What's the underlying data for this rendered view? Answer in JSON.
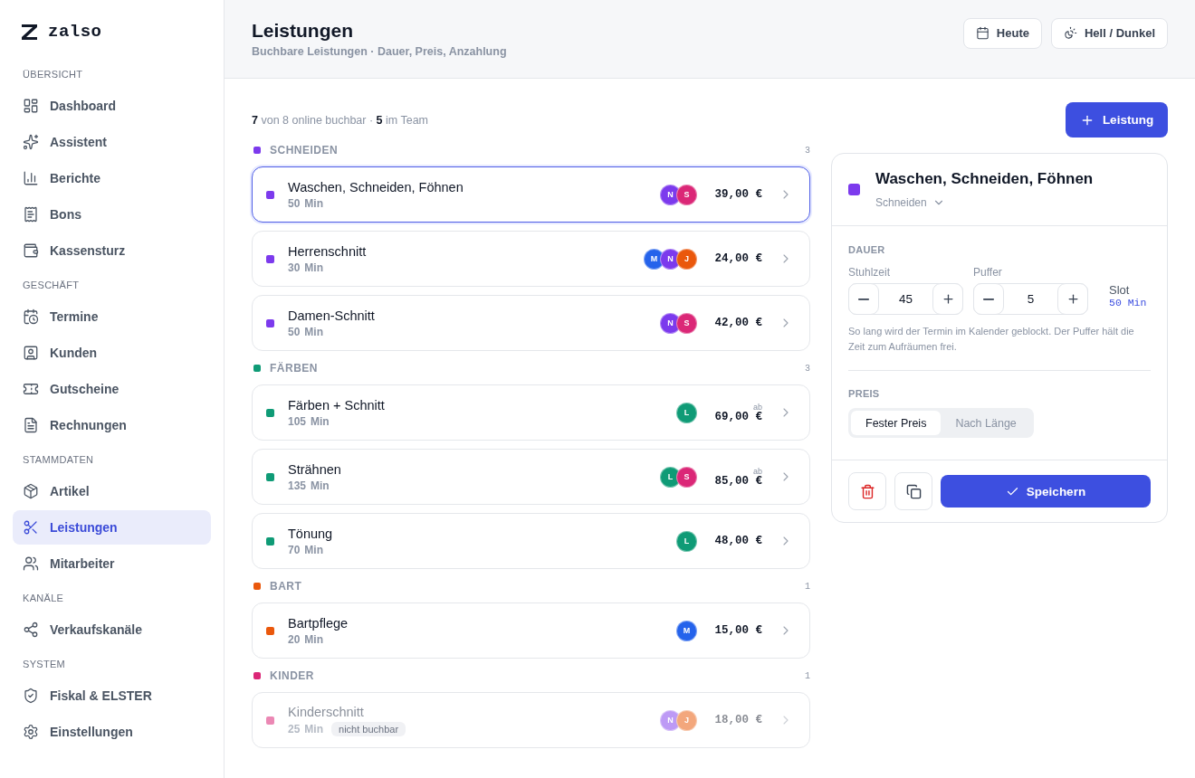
{
  "brand": {
    "name": "zalso"
  },
  "sidebar": {
    "sections": [
      {
        "title": "ÜBERSICHT",
        "items": [
          {
            "label": "Dashboard",
            "selected": false
          },
          {
            "label": "Assistent",
            "selected": false
          },
          {
            "label": "Berichte",
            "selected": false
          },
          {
            "label": "Bons",
            "selected": false
          },
          {
            "label": "Kassensturz",
            "selected": false
          }
        ]
      },
      {
        "title": "GESCHÄFT",
        "items": [
          {
            "label": "Termine",
            "selected": false
          },
          {
            "label": "Kunden",
            "selected": false
          },
          {
            "label": "Gutscheine",
            "selected": false
          },
          {
            "label": "Rechnungen",
            "selected": false
          }
        ]
      },
      {
        "title": "STAMMDATEN",
        "items": [
          {
            "label": "Artikel",
            "selected": false
          },
          {
            "label": "Leistungen",
            "selected": true
          },
          {
            "label": "Mitarbeiter",
            "selected": false
          }
        ]
      },
      {
        "title": "KANÄLE",
        "items": [
          {
            "label": "Verkaufskanäle",
            "selected": false
          }
        ]
      },
      {
        "title": "SYSTEM",
        "items": [
          {
            "label": "Fiskal & ELSTER",
            "selected": false
          },
          {
            "label": "Einstellungen",
            "selected": false
          }
        ]
      }
    ]
  },
  "header": {
    "title": "Leistungen",
    "subtitle": "Buchbare Leistungen · Dauer, Preis, Anzahlung",
    "buttons": [
      {
        "label": "Heute"
      },
      {
        "label": "Hell / Dunkel"
      }
    ]
  },
  "summary": "**7** von 8 online buchbar · **5** im Team",
  "add_button": {
    "label": "Leistung"
  },
  "groups": [
    {
      "name": "SCHNEIDEN",
      "color": "#7c3aed",
      "count": "3",
      "services": [
        {
          "name": "Waschen, Schneiden, Föhnen",
          "duration": "50",
          "unit": "Min",
          "staff": [
            {
              "initial": "N",
              "color": "#7c3aed"
            },
            {
              "initial": "S",
              "color": "#db2777"
            }
          ],
          "price": "39,00 €",
          "selected": true,
          "bookable": true
        },
        {
          "name": "Herrenschnitt",
          "duration": "30",
          "unit": "Min",
          "staff": [
            {
              "initial": "M",
              "color": "#2563eb"
            },
            {
              "initial": "N",
              "color": "#7c3aed"
            },
            {
              "initial": "J",
              "color": "#ea580c"
            }
          ],
          "price": "24,00 €",
          "selected": false,
          "bookable": true
        },
        {
          "name": "Damen-Schnitt",
          "duration": "50",
          "unit": "Min",
          "staff": [
            {
              "initial": "N",
              "color": "#7c3aed"
            },
            {
              "initial": "S",
              "color": "#db2777"
            }
          ],
          "price": "42,00 €",
          "selected": false,
          "bookable": true
        }
      ]
    },
    {
      "name": "FÄRBEN",
      "color": "#0f9b76",
      "count": "3",
      "services": [
        {
          "name": "Färben + Schnitt",
          "duration": "105",
          "unit": "Min",
          "staff": [
            {
              "initial": "L",
              "color": "#0f9b76"
            }
          ],
          "price_prefix": "ab",
          "price": "69,00 €",
          "selected": false,
          "bookable": true
        },
        {
          "name": "Strähnen",
          "duration": "135",
          "unit": "Min",
          "staff": [
            {
              "initial": "L",
              "color": "#0f9b76"
            },
            {
              "initial": "S",
              "color": "#db2777"
            }
          ],
          "price_prefix": "ab",
          "price": "85,00 €",
          "selected": false,
          "bookable": true
        },
        {
          "name": "Tönung",
          "duration": "70",
          "unit": "Min",
          "staff": [
            {
              "initial": "L",
              "color": "#0f9b76"
            }
          ],
          "price": "48,00 €",
          "selected": false,
          "bookable": true
        }
      ]
    },
    {
      "name": "BART",
      "color": "#ea580c",
      "count": "1",
      "services": [
        {
          "name": "Bartpflege",
          "duration": "20",
          "unit": "Min",
          "staff": [
            {
              "initial": "M",
              "color": "#2563eb"
            }
          ],
          "price": "15,00 €",
          "selected": false,
          "bookable": true
        }
      ]
    },
    {
      "name": "KINDER",
      "color": "#db2777",
      "count": "1",
      "services": [
        {
          "name": "Kinderschnitt",
          "duration": "25",
          "unit": "Min",
          "staff": [
            {
              "initial": "N",
              "color": "#bd9af5"
            },
            {
              "initial": "J",
              "color": "#f3a77c"
            }
          ],
          "price": "18,00 €",
          "selected": false,
          "bookable": false,
          "badge": "nicht buchbar"
        }
      ]
    }
  ],
  "detail": {
    "title": "Waschen, Schneiden, Föhnen",
    "color": "#7c3aed",
    "category": "Schneiden",
    "duration": {
      "label": "DAUER",
      "steppers": [
        {
          "label": "Stuhlzeit",
          "value": "45"
        },
        {
          "label": "Puffer",
          "value": "5"
        }
      ],
      "slot": {
        "label": "Slot",
        "value": "50 Min"
      },
      "hint": "So lang wird der Termin im Kalender geblockt. Der Puffer hält die Zeit zum Aufräumen frei."
    },
    "price": {
      "label": "PREIS",
      "options": [
        {
          "label": "Fester Preis",
          "selected": true
        },
        {
          "label": "Nach Länge",
          "selected": false
        }
      ]
    },
    "save_button": {
      "label": "Speichern"
    }
  }
}
